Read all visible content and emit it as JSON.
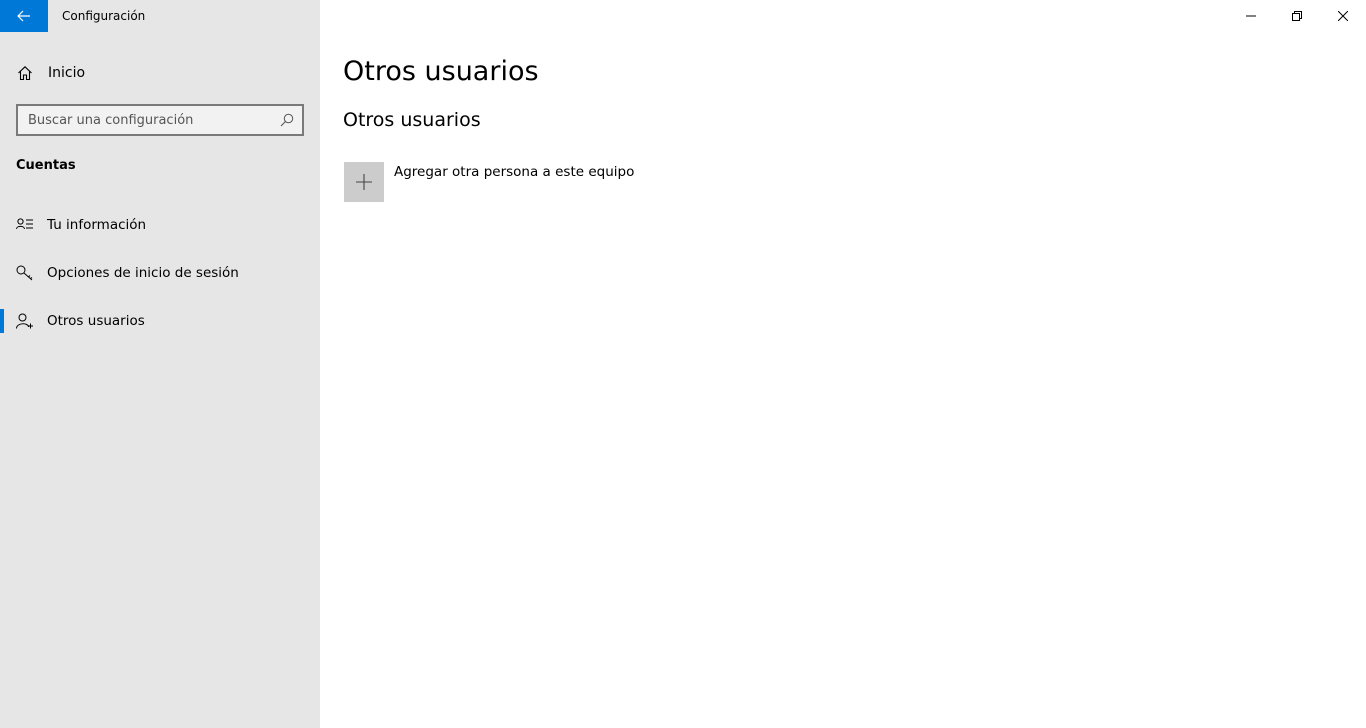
{
  "window": {
    "title": "Configuración",
    "accent_color": "#0078d7",
    "controls": [
      "minimize-icon",
      "restore-icon",
      "close-icon"
    ]
  },
  "sidebar": {
    "home_label": "Inicio",
    "search": {
      "placeholder": "Buscar una configuración",
      "value": ""
    },
    "section_title": "Cuentas",
    "items": [
      {
        "label": "Tu información",
        "icon": "contact-card-icon",
        "active": false
      },
      {
        "label": "Opciones de inicio de sesión",
        "icon": "key-icon",
        "active": false
      },
      {
        "label": "Otros usuarios",
        "icon": "add-user-icon",
        "active": true
      }
    ]
  },
  "main": {
    "page_title": "Otros usuarios",
    "section_title": "Otros usuarios",
    "add_person_label": "Agregar otra persona a este equipo"
  }
}
